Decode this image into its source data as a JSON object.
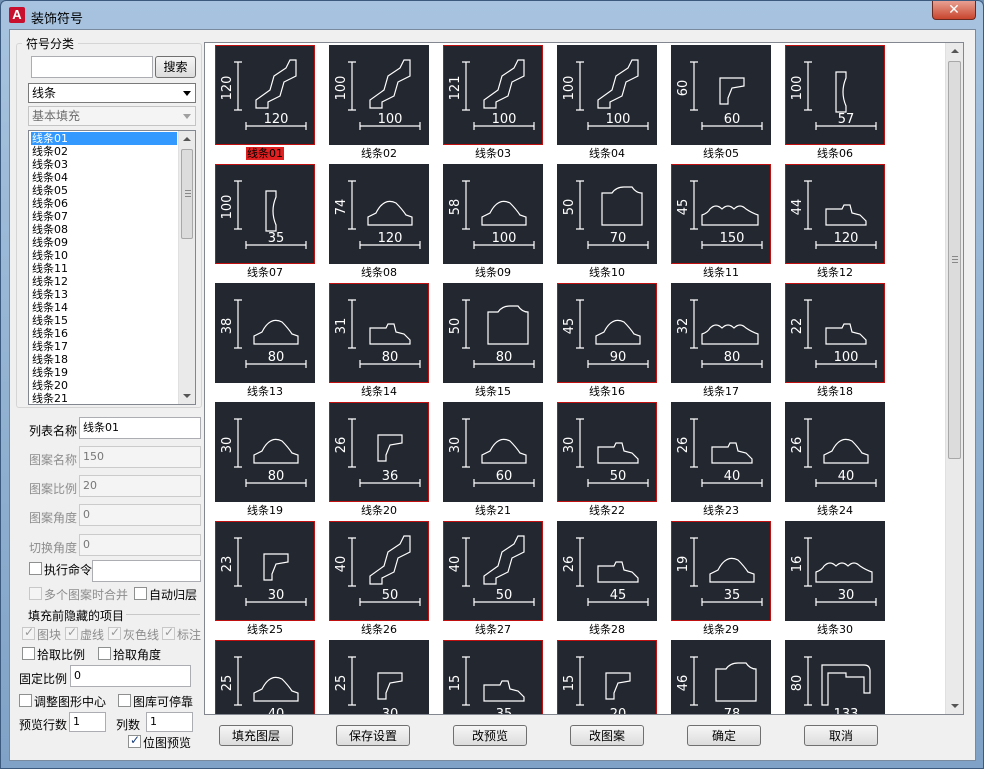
{
  "window": {
    "title": "装饰符号",
    "app_icon": "A",
    "close_glyph": "✕"
  },
  "left": {
    "group_title": "符号分类",
    "search_value": "",
    "search_button": "搜索",
    "category_select": "线条",
    "subcategory_select": "基本填充",
    "list_items": [
      "线条01",
      "线条02",
      "线条03",
      "线条04",
      "线条05",
      "线条06",
      "线条07",
      "线条08",
      "线条09",
      "线条10",
      "线条11",
      "线条12",
      "线条13",
      "线条14",
      "线条15",
      "线条16",
      "线条17",
      "线条18",
      "线条19",
      "线条20",
      "线条21"
    ],
    "selected_index": 0,
    "list_name_label": "列表名称",
    "list_name_value": "线条01",
    "pattern_name_label": "图案名称",
    "pattern_name_value": "150",
    "pattern_scale_label": "图案比例",
    "pattern_scale_value": "20",
    "pattern_angle_label": "图案角度",
    "pattern_angle_value": "0",
    "switch_angle_label": "切换角度",
    "switch_angle_value": "0",
    "exec_cmd_label": "执行命令",
    "exec_cmd_value": "",
    "merge_label": "多个图案时合并",
    "auto_layer_label": "自动归层",
    "hide_group_title": "填充前隐藏的项目",
    "hide_block": "图块",
    "hide_dashed": "虚线",
    "hide_gray": "灰色线",
    "hide_annot": "标注",
    "pick_scale": "拾取比例",
    "pick_angle": "拾取角度",
    "fixed_scale_label": "固定比例",
    "fixed_scale_value": "0",
    "adjust_center": "调整图形中心",
    "lib_dock": "图库可停靠",
    "preview_rows_label": "预览行数",
    "preview_rows_value": "1",
    "cols_label": "列数",
    "cols_value": "1",
    "bitmap_preview": "位图预览"
  },
  "tiles": [
    {
      "caption": "线条01",
      "dims": [
        "120",
        "120"
      ],
      "shape": "cornice"
    },
    {
      "caption": "线条02",
      "dims": [
        "100",
        "100"
      ],
      "shape": "cornice"
    },
    {
      "caption": "线条03",
      "dims": [
        "121",
        "100"
      ],
      "shape": "cornice"
    },
    {
      "caption": "线条04",
      "dims": [
        "100",
        "100"
      ],
      "shape": "cornice"
    },
    {
      "caption": "线条05",
      "dims": [
        "60",
        "60"
      ],
      "shape": "corner"
    },
    {
      "caption": "线条06",
      "dims": [
        "100",
        "57"
      ],
      "shape": "cove"
    },
    {
      "caption": "线条07",
      "dims": [
        "100",
        "35"
      ],
      "shape": "cove"
    },
    {
      "caption": "线条08",
      "dims": [
        "74",
        "120"
      ],
      "shape": "arch"
    },
    {
      "caption": "线条09",
      "dims": [
        "58",
        "100"
      ],
      "shape": "arch"
    },
    {
      "caption": "线条10",
      "dims": [
        "50",
        "70"
      ],
      "shape": "block"
    },
    {
      "caption": "线条11",
      "dims": [
        "45",
        "150"
      ],
      "shape": "wave"
    },
    {
      "caption": "线条12",
      "dims": [
        "44",
        "120"
      ],
      "shape": "step"
    },
    {
      "caption": "线条13",
      "dims": [
        "38",
        "80"
      ],
      "shape": "arch"
    },
    {
      "caption": "线条14",
      "dims": [
        "31",
        "80"
      ],
      "shape": "step"
    },
    {
      "caption": "线条15",
      "dims": [
        "50",
        "80"
      ],
      "shape": "block"
    },
    {
      "caption": "线条16",
      "dims": [
        "45",
        "90"
      ],
      "shape": "arch"
    },
    {
      "caption": "线条17",
      "dims": [
        "32",
        "80"
      ],
      "shape": "wave"
    },
    {
      "caption": "线条18",
      "dims": [
        "22",
        "100"
      ],
      "shape": "step"
    },
    {
      "caption": "线条19",
      "dims": [
        "30",
        "80"
      ],
      "shape": "arch"
    },
    {
      "caption": "线条20",
      "dims": [
        "26",
        "36"
      ],
      "shape": "corner"
    },
    {
      "caption": "线条21",
      "dims": [
        "30",
        "60"
      ],
      "shape": "arch"
    },
    {
      "caption": "线条22",
      "dims": [
        "30",
        "50"
      ],
      "shape": "step"
    },
    {
      "caption": "线条23",
      "dims": [
        "26",
        "40"
      ],
      "shape": "step"
    },
    {
      "caption": "线条24",
      "dims": [
        "26",
        "40"
      ],
      "shape": "arch"
    },
    {
      "caption": "线条25",
      "dims": [
        "23",
        "30"
      ],
      "shape": "corner"
    },
    {
      "caption": "线条26",
      "dims": [
        "40",
        "50"
      ],
      "shape": "cornice"
    },
    {
      "caption": "线条27",
      "dims": [
        "40",
        "50"
      ],
      "shape": "cornice"
    },
    {
      "caption": "线条28",
      "dims": [
        "26",
        "45"
      ],
      "shape": "step"
    },
    {
      "caption": "线条29",
      "dims": [
        "19",
        "35"
      ],
      "shape": "arch"
    },
    {
      "caption": "线条30",
      "dims": [
        "16",
        "30"
      ],
      "shape": "wave"
    },
    {
      "caption": "",
      "dims": [
        "25",
        "40"
      ],
      "shape": "arch"
    },
    {
      "caption": "",
      "dims": [
        "25",
        "30"
      ],
      "shape": "corner"
    },
    {
      "caption": "",
      "dims": [
        "15",
        "35"
      ],
      "shape": "step"
    },
    {
      "caption": "",
      "dims": [
        "15",
        "20"
      ],
      "shape": "corner"
    },
    {
      "caption": "",
      "dims": [
        "46",
        "78"
      ],
      "shape": "block"
    },
    {
      "caption": "",
      "dims": [
        "80",
        "133"
      ],
      "shape": "ledge"
    }
  ],
  "red_border_tiles": [
    0,
    2,
    5,
    6,
    10,
    11,
    13,
    15,
    17,
    19,
    21,
    24,
    25,
    26,
    28,
    30,
    32,
    33
  ],
  "buttons": [
    "填充图层",
    "保存设置",
    "改预览",
    "改图案",
    "确定",
    "取消"
  ]
}
